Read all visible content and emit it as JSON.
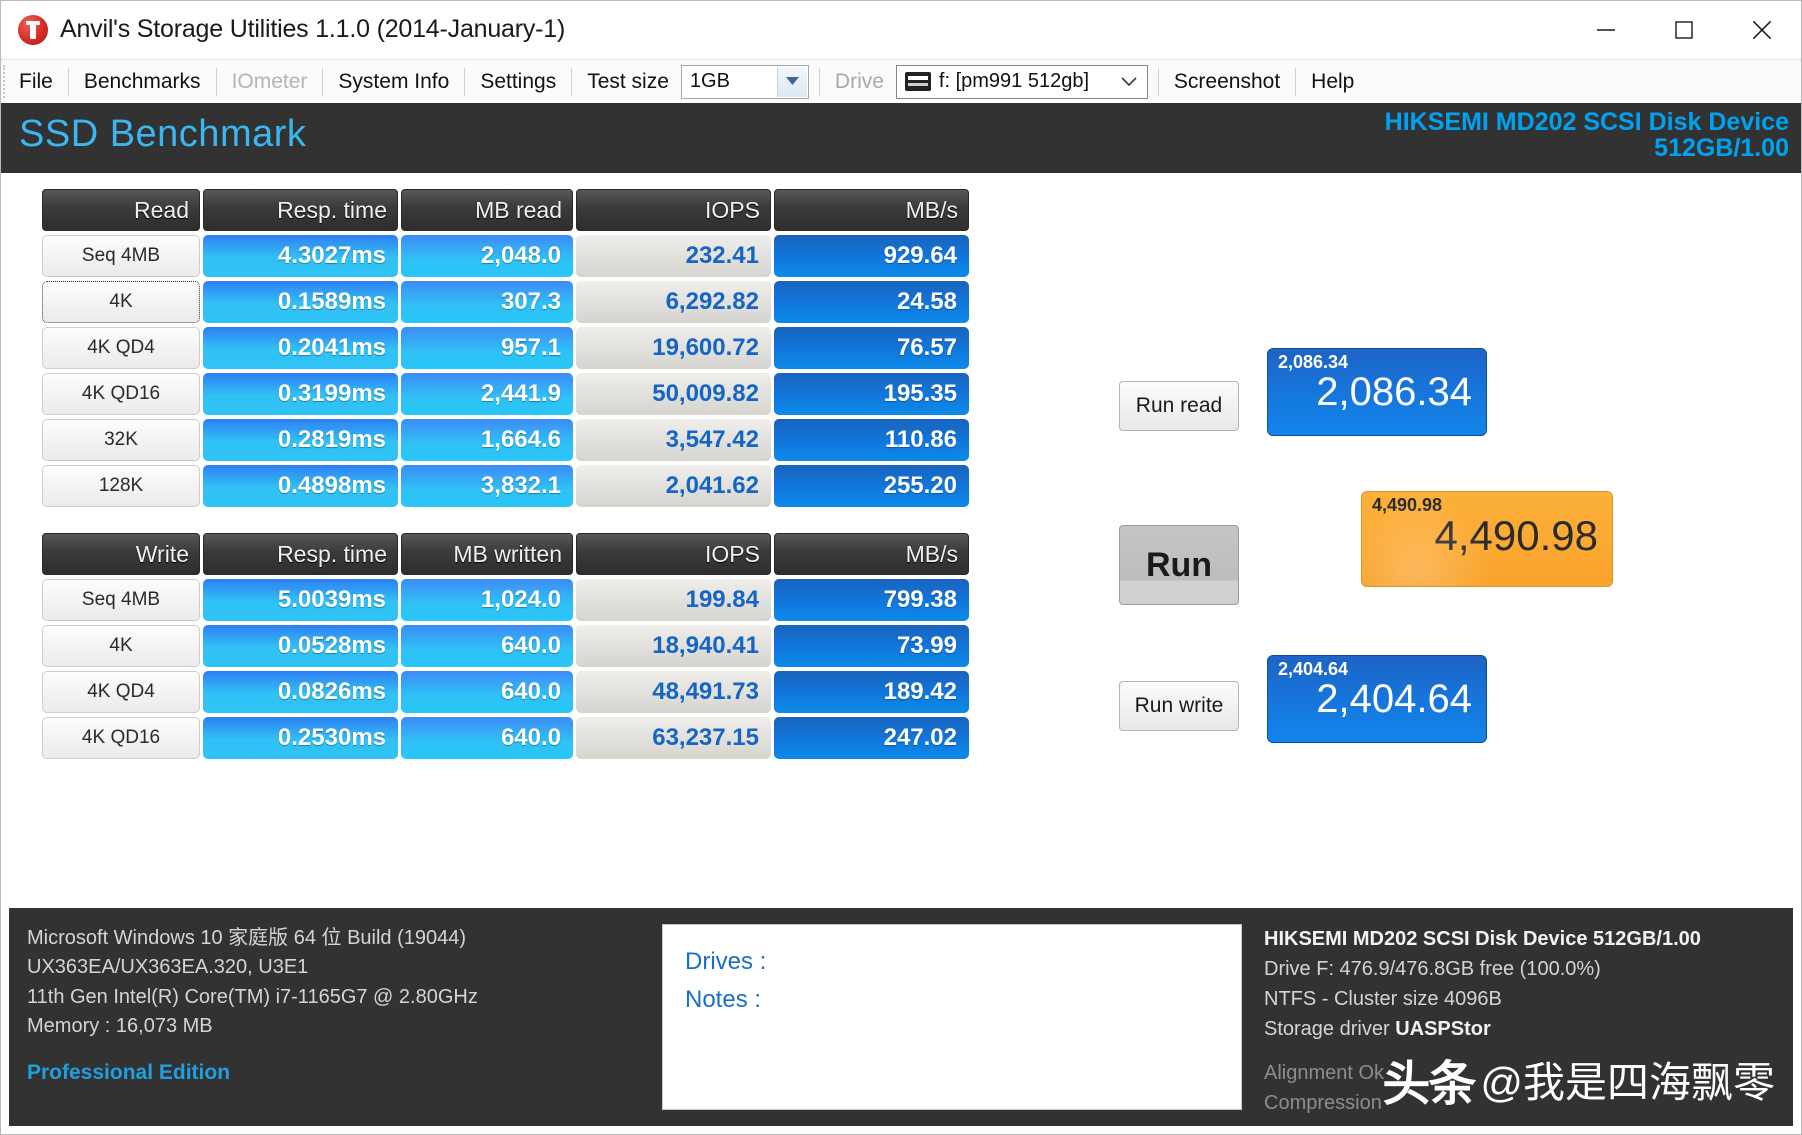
{
  "window": {
    "title": "Anvil's Storage Utilities 1.1.0 (2014-January-1)",
    "app_icon": "anvil-icon",
    "minimize": "minimize-icon",
    "maximize": "maximize-icon",
    "close": "close-icon"
  },
  "menu": {
    "items": [
      {
        "label": "File",
        "disabled": false
      },
      {
        "label": "Benchmarks",
        "disabled": false
      },
      {
        "label": "IOmeter",
        "disabled": true
      },
      {
        "label": "System Info",
        "disabled": false
      },
      {
        "label": "Settings",
        "disabled": false
      }
    ],
    "test_size_label": "Test size",
    "test_size_value": "1GB",
    "drive_label": "Drive",
    "drive_value": "f: [pm991 512gb]",
    "screenshot": "Screenshot",
    "help": "Help"
  },
  "header": {
    "title": "SSD Benchmark",
    "device_name": "HIKSEMI MD202 SCSI Disk Device",
    "device_capacity": "512GB/1.00",
    "accent": "#00a2f0",
    "title_color": "#3bb7f0",
    "bg": "#323232"
  },
  "read_table": {
    "columns": [
      "Read",
      "Resp. time",
      "MB read",
      "IOPS",
      "MB/s"
    ],
    "rows": [
      {
        "label": "Seq 4MB",
        "resp": "4.3027ms",
        "mb": "2,048.0",
        "iops": "232.41",
        "mbs": "929.64",
        "focused": false
      },
      {
        "label": "4K",
        "resp": "0.1589ms",
        "mb": "307.3",
        "iops": "6,292.82",
        "mbs": "24.58",
        "focused": true
      },
      {
        "label": "4K QD4",
        "resp": "0.2041ms",
        "mb": "957.1",
        "iops": "19,600.72",
        "mbs": "76.57",
        "focused": false
      },
      {
        "label": "4K QD16",
        "resp": "0.3199ms",
        "mb": "2,441.9",
        "iops": "50,009.82",
        "mbs": "195.35",
        "focused": false
      },
      {
        "label": "32K",
        "resp": "0.2819ms",
        "mb": "1,664.6",
        "iops": "3,547.42",
        "mbs": "110.86",
        "focused": false
      },
      {
        "label": "128K",
        "resp": "0.4898ms",
        "mb": "3,832.1",
        "iops": "2,041.62",
        "mbs": "255.20",
        "focused": false
      }
    ]
  },
  "write_table": {
    "columns": [
      "Write",
      "Resp. time",
      "MB written",
      "IOPS",
      "MB/s"
    ],
    "rows": [
      {
        "label": "Seq 4MB",
        "resp": "5.0039ms",
        "mb": "1,024.0",
        "iops": "199.84",
        "mbs": "799.38",
        "focused": false
      },
      {
        "label": "4K",
        "resp": "0.0528ms",
        "mb": "640.0",
        "iops": "18,940.41",
        "mbs": "73.99",
        "focused": false
      },
      {
        "label": "4K QD4",
        "resp": "0.0826ms",
        "mb": "640.0",
        "iops": "48,491.73",
        "mbs": "189.42",
        "focused": false
      },
      {
        "label": "4K QD16",
        "resp": "0.2530ms",
        "mb": "640.0",
        "iops": "63,237.15",
        "mbs": "247.02",
        "focused": false
      }
    ]
  },
  "controls": {
    "run_read": "Run read",
    "run": "Run",
    "run_write": "Run write"
  },
  "scores": {
    "read_small": "2,086.34",
    "read_big": "2,086.34",
    "total_small": "4,490.98",
    "total_big": "4,490.98",
    "write_small": "2,404.64",
    "write_big": "2,404.64",
    "read_color": "#1677dd",
    "total_color": "#fcab34",
    "write_color": "#1677dd"
  },
  "system_info": {
    "os": "Microsoft Windows 10 家庭版 64 位 Build (19044)",
    "machine": "UX363EA/UX363EA.320, U3E1",
    "cpu": "11th Gen Intel(R) Core(TM) i7-1165G7 @ 2.80GHz",
    "memory": "Memory : 16,073 MB",
    "edition": "Professional Edition"
  },
  "notes_panel": {
    "drives_label": "Drives :",
    "notes_label": "Notes :"
  },
  "drive_info": {
    "device": "HIKSEMI MD202 SCSI Disk Device 512GB/1.00",
    "free": "Drive F: 476.9/476.8GB free (100.0%)",
    "fs": "NTFS - Cluster size 4096B",
    "driver_label": "Storage driver",
    "driver_value": "UASPStor",
    "alignment": "Alignment  Ok",
    "compression": "Compression"
  },
  "watermark": {
    "logo": "头条",
    "handle": "@我是四海飘零"
  }
}
